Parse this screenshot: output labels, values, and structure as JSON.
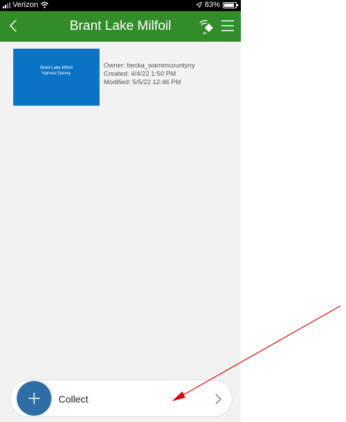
{
  "status_bar": {
    "carrier": "Verizon",
    "battery": "83%"
  },
  "nav": {
    "title": "Brant Lake Milfoil"
  },
  "survey": {
    "thumbnail_line1": "Brant Lake Milfoil",
    "thumbnail_line2": "Harvest Survey",
    "owner": "Owner: becka_warrencountyny",
    "created": "Created: 4/4/22 1:50 PM",
    "modified": "Modified: 5/5/22 12:46 PM"
  },
  "collect": {
    "label": "Collect"
  },
  "colors": {
    "nav_green": "#338c2a",
    "thumbnail_blue": "#0a73c4",
    "collect_blue": "#2e6ea4",
    "annotation_red": "#e00000"
  },
  "icons": {
    "back": "chevron-left-icon",
    "gps": "gps-signal-icon",
    "menu": "hamburger-menu-icon",
    "add": "plus-icon",
    "chevron": "chevron-right-icon"
  }
}
